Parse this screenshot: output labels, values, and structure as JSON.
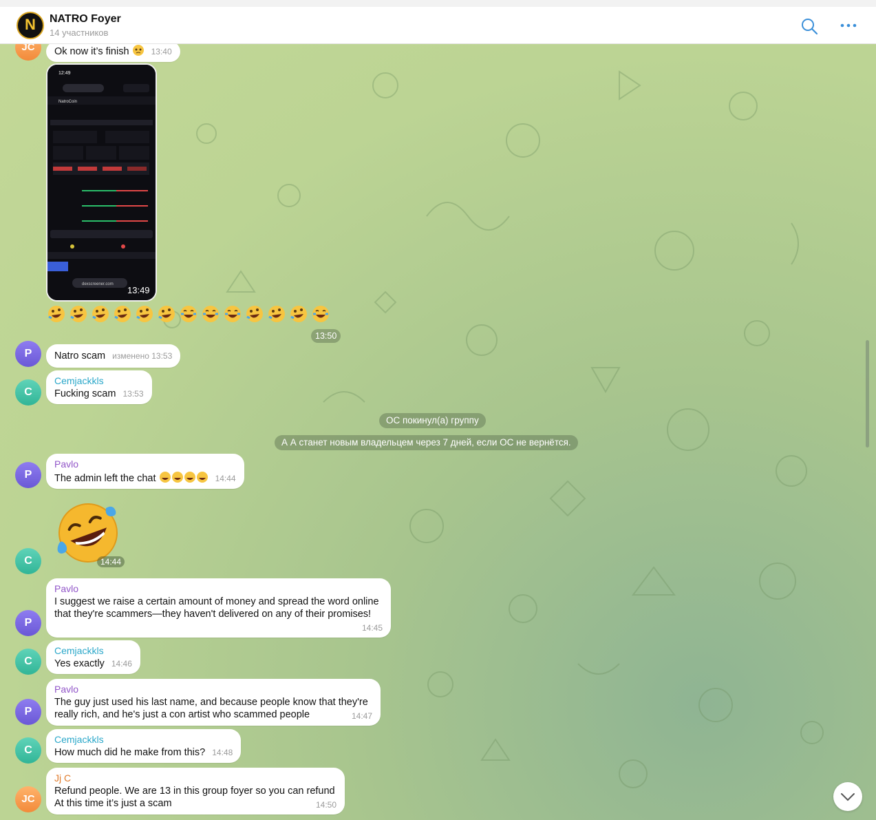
{
  "header": {
    "logo_letter": "N",
    "title": "NATRO Foyer",
    "subtitle": "14 участников",
    "search_icon": "search-icon",
    "more_icon": "more-dots-icon",
    "accent_color": "#3a8fd9"
  },
  "messages": {
    "top": {
      "avatar": "JC",
      "text": "Ok now it’s finish",
      "time": "13:40"
    },
    "screenshot": {
      "time": "13:49",
      "url": "dexscreener.com",
      "token": "NatroCoin"
    },
    "emoji_row": {
      "time": "13:50"
    },
    "m1": {
      "avatar": "P",
      "text": "Natro scam",
      "edited": "изменено 13:53"
    },
    "m2": {
      "avatar": "C",
      "sender": "Cemjackkls",
      "text": "Fucking scam",
      "time": "13:53"
    },
    "service1": "OC покинул(а) группу",
    "service2": "А А станет новым владельцем через 7 дней, если OC не вернётся.",
    "m3": {
      "avatar": "P",
      "sender": "Pavlo",
      "text": "The admin left the chat",
      "time": "14:44"
    },
    "m4": {
      "avatar": "C",
      "time": "14:44"
    },
    "m5": {
      "avatar": "P",
      "sender": "Pavlo",
      "line1": "I suggest we raise a certain amount of money and spread the word online",
      "line2": "that they're scammers—they haven't delivered on any of their promises!",
      "time": "14:45"
    },
    "m6": {
      "avatar": "C",
      "sender": "Cemjackkls",
      "text": "Yes exactly",
      "time": "14:46"
    },
    "m7": {
      "avatar": "P",
      "sender": "Pavlo",
      "line1": "The guy just used his last name, and because people know that they're",
      "line2": "really rich, and he's just a con artist who scammed people",
      "time": "14:47"
    },
    "m8": {
      "avatar": "C",
      "sender": "Cemjackkls",
      "text": "How much did he make from this?",
      "time": "14:48"
    },
    "m9": {
      "avatar": "JC",
      "sender": "Jj C",
      "line1": "Refund people. We are 13 in this group foyer so you can refund",
      "line2": "At this time it’s just a scam",
      "time": "14:50"
    }
  },
  "controls": {
    "scroll_down_icon": "chevron-down-icon"
  }
}
